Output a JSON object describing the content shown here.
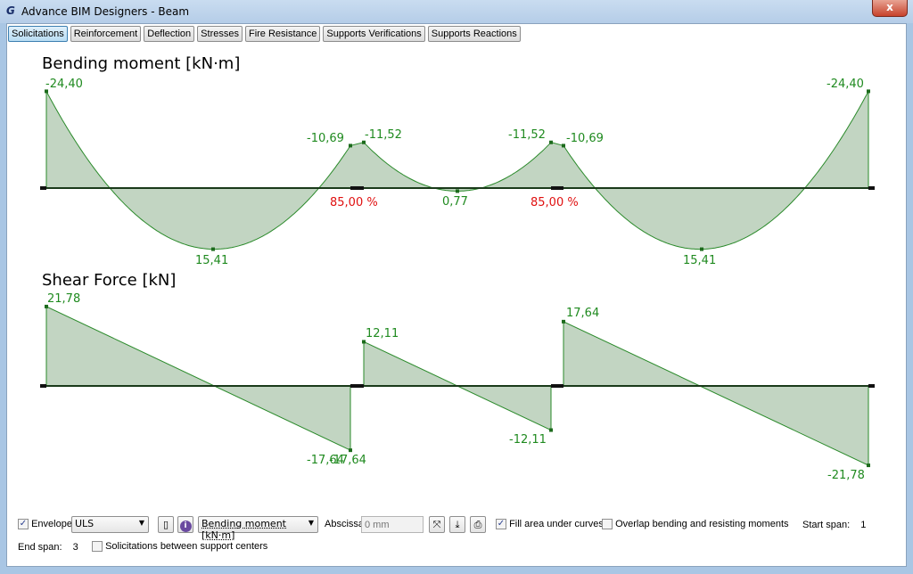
{
  "window": {
    "title": "Advance BIM Designers - Beam",
    "logo": "G",
    "close_label": "x"
  },
  "tabs": [
    {
      "label": "Solicitations",
      "active": true
    },
    {
      "label": "Reinforcement"
    },
    {
      "label": "Deflection"
    },
    {
      "label": "Stresses"
    },
    {
      "label": "Fire Resistance"
    },
    {
      "label": "Supports Verifications"
    },
    {
      "label": "Supports Reactions"
    }
  ],
  "colors": {
    "fill": "#c2d5c2",
    "curve": "#2a8a2a",
    "label": "#1f8a1f",
    "percent": "#e01010"
  },
  "chart_data": [
    {
      "type": "area",
      "title": "Bending moment [kN·m]",
      "labels": [
        "-24,40",
        "15,41",
        "-10,69",
        "-11,52",
        "0,77",
        "-11,52",
        "-10,69",
        "15,41",
        "-24,40"
      ],
      "values": [
        -24.4,
        15.41,
        -10.69,
        -11.52,
        0.77,
        -11.52,
        -10.69,
        15.41,
        -24.4
      ],
      "support_ratios": [
        "85,00 %",
        "85,00 %"
      ]
    },
    {
      "type": "area",
      "title": "Shear Force [kN]",
      "labels": [
        "21,78",
        "-17,64",
        "-17,64",
        "12,11",
        "-12,11",
        "17,64",
        "-21,78"
      ],
      "values": [
        21.78,
        -17.64,
        -17.64,
        12.11,
        -12.11,
        17.64,
        -21.78
      ]
    }
  ],
  "controls": {
    "envelope_label": "Envelope",
    "envelope_checked": true,
    "envelope_value": "ULS",
    "diagram_select": "Bending moment [kN·m]",
    "abscissa_label": "Abscissa",
    "abscissa_placeholder": "0 mm",
    "fill_label": "Fill area under curves",
    "fill_checked": true,
    "overlap_label": "Overlap bending and resisting moments",
    "overlap_checked": false,
    "start_span_label": "Start span:",
    "start_span_value": "1",
    "end_span_label": "End span:",
    "end_span_value": "3",
    "between_label": "Solicitations between support centers",
    "between_checked": false
  }
}
